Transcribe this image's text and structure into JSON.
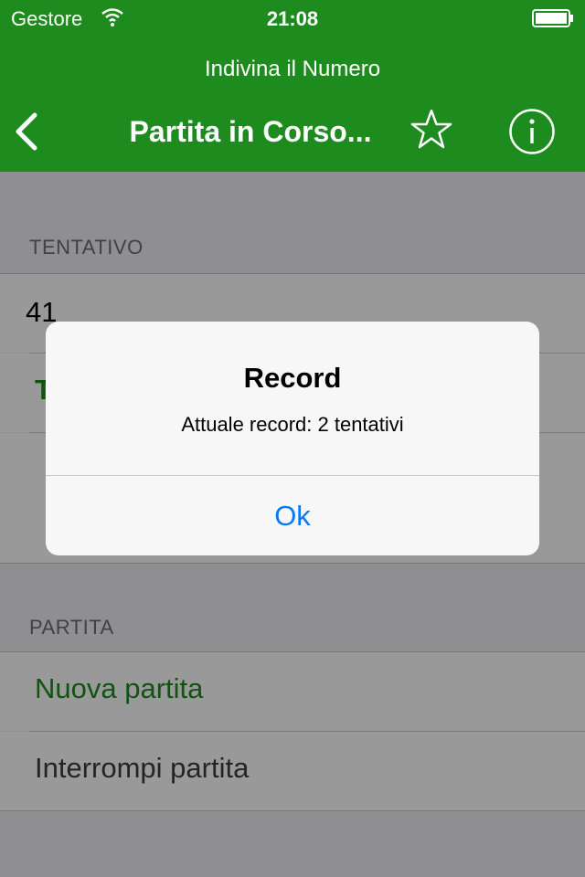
{
  "status_bar": {
    "carrier": "Gestore",
    "time": "21:08"
  },
  "header": {
    "app_title": "Indivina il Numero",
    "nav_title": "Partita in Corso..."
  },
  "sections": {
    "guess": {
      "header": "TENTATIVO",
      "input_value": "41",
      "try_button_partial": "T"
    },
    "game": {
      "header": "PARTITA",
      "new_game": "Nuova partita",
      "quit_game": "Interrompi partita"
    }
  },
  "alert": {
    "title": "Record",
    "message": "Attuale record: 2 tentativi",
    "ok_label": "Ok"
  },
  "colors": {
    "header_green": "#1e8b1e",
    "action_green": "#1e8b1e",
    "alert_button_blue": "#007aff",
    "disabled_text": "#3d3d3d"
  }
}
